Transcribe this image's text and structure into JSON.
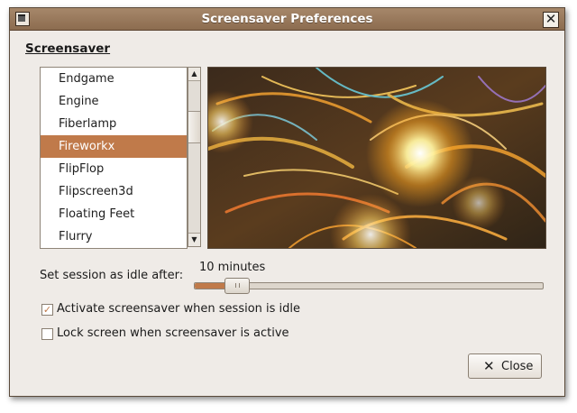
{
  "window": {
    "title": "Screensaver Preferences"
  },
  "section": {
    "title": "Screensaver"
  },
  "screensaver_list": {
    "items": [
      "Endgame",
      "Engine",
      "Fiberlamp",
      "Fireworkx",
      "FlipFlop",
      "Flipscreen3d",
      "Floating Feet",
      "Flurry"
    ],
    "selected": "Fireworkx"
  },
  "idle": {
    "label": "Set session as idle after:",
    "value_text": "10 minutes",
    "slider_fraction": 0.12
  },
  "options": {
    "activate_label": "Activate screensaver when session is idle",
    "activate_checked": true,
    "lock_label": "Lock screen when screensaver is active",
    "lock_checked": false
  },
  "buttons": {
    "close_label": "Close"
  },
  "icons": {
    "window_icon": "display-icon",
    "close_window": "close-icon",
    "close_button": "x-icon"
  },
  "colors": {
    "accent": "#c07a4a",
    "titlebar": "#9a7b5e",
    "window_bg": "#efebe7"
  }
}
